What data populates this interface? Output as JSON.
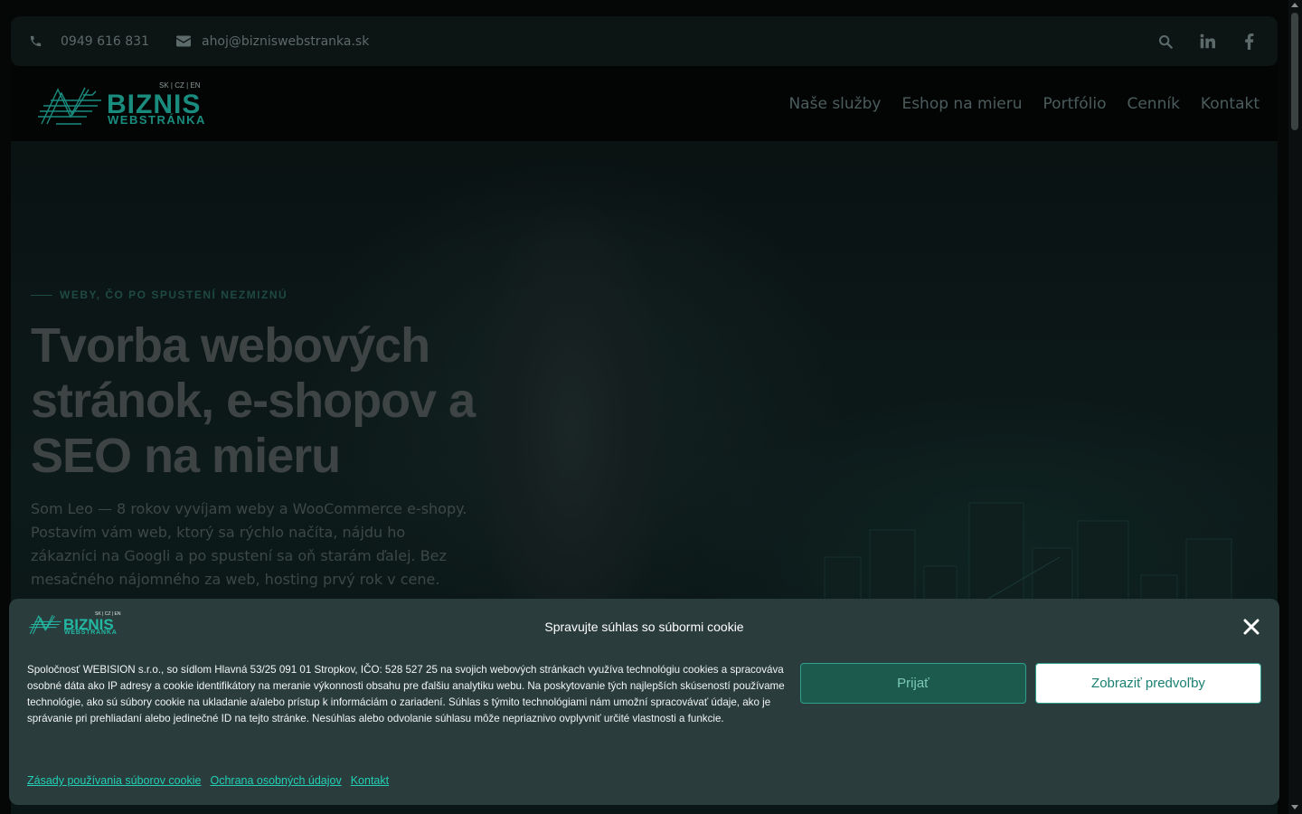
{
  "topbar": {
    "phone": "0949 616 831",
    "email": "ahoj@bizniswebstranka.sk",
    "icons": [
      "phone-icon",
      "envelope-icon",
      "search-icon",
      "linkedin-icon",
      "facebook-icon"
    ]
  },
  "logo": {
    "brand_line1": "BIZNIS",
    "brand_line2": "WEBSTRÁNKA",
    "languages": "SK | CZ | EN"
  },
  "nav": {
    "items": [
      "Naše služby",
      "Eshop na mieru",
      "Portfólio",
      "Cenník",
      "Kontakt"
    ]
  },
  "hero": {
    "eyebrow": "WEBY, ČO PO SPUSTENÍ NEZMIZNÚ",
    "title": "Tvorba webových stránok, e-shopov a SEO na mieru",
    "description": "Som Leo — 8 rokov vyvíjam weby a WooCommerce e-shopy. Postavím vám web, ktorý sa rýchlo načíta, nájdu ho zákazníci na Googli a po spustení sa oň starám ďalej. Bez mesačného nájomného za web, hosting prvý rok v cene."
  },
  "cookie": {
    "logo_line1": "BIZNIS",
    "logo_line2": "WEBSTRÁNKA",
    "logo_languages": "SK | CZ | EN",
    "title": "Spravujte súhlas so súbormi cookie",
    "text": "Spoločnosť WEBISION s.r.o., so sídlom Hlavná 53/25 091 01 Stropkov, IČO: 528 527 25 na svojich webových stránkach  využíva technológiu cookies a spracováva osobné dáta ako IP adresy a cookie identifikátory na meranie výkonnosti obsahu pre ďalšiu analytiku webu. Na poskytovanie tých najlepších skúseností používame technológie, ako sú súbory cookie na ukladanie a/alebo prístup k informáciám o zariadení. Súhlas s týmito technológiami nám umožní spracovávať údaje, ako je správanie pri prehliadaní alebo jedinečné ID na tejto stránke. Nesúhlas alebo odvolanie súhlasu môže nepriaznivo ovplyvniť určité vlastnosti a funkcie.",
    "accept_label": "Prijať",
    "preferences_label": "Zobraziť predvoľby",
    "links": [
      "Zásady používania súborov cookie",
      "Ochrana osobných údajov",
      "Kontakt"
    ],
    "colors": {
      "panel": "#2a3c3c",
      "accent": "#22d0b6",
      "accept_bg": "#1c5a4e"
    }
  }
}
